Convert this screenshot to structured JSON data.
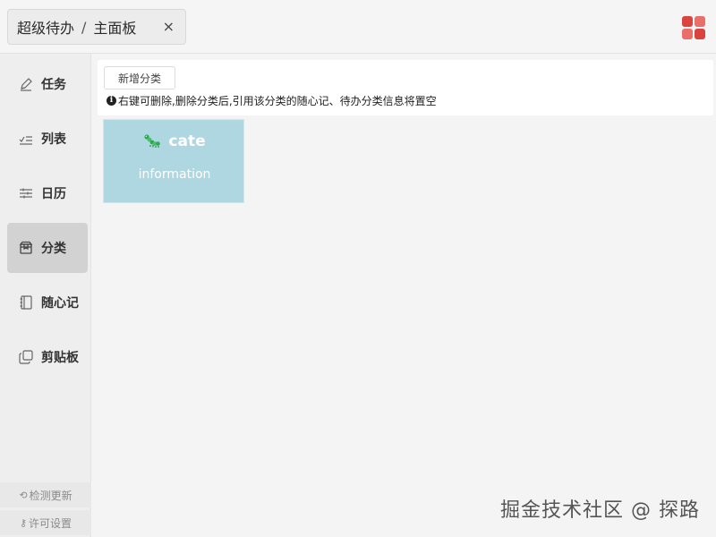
{
  "header": {
    "breadcrumb_root": "超级待办",
    "breadcrumb_sep": "/",
    "breadcrumb_current": "主面板",
    "close_glyph": "×",
    "app_icon": "app-grid-icon"
  },
  "sidebar": {
    "items": [
      {
        "label": "任务",
        "icon": "pencil-icon"
      },
      {
        "label": "列表",
        "icon": "checklist-icon"
      },
      {
        "label": "日历",
        "icon": "sliders-icon"
      },
      {
        "label": "分类",
        "icon": "box-icon",
        "active": true
      },
      {
        "label": "随心记",
        "icon": "notebook-icon"
      },
      {
        "label": "剪贴板",
        "icon": "copy-icon"
      }
    ],
    "check_update": "检测更新",
    "license": "许可设置"
  },
  "toolbar": {
    "add_button": "新增分类",
    "hint": "右键可删除,删除分类后,引用该分类的随心记、待办分类信息将置空",
    "hint_icon": "i"
  },
  "cards": [
    {
      "title": "cate",
      "description": "information",
      "icon": "caterpillar-icon",
      "color": "#afd7e1"
    }
  ],
  "watermark": "掘金技术社区 @ 探路",
  "colors": {
    "accent_red": "#d9443f",
    "card_bg": "#afd7e1",
    "active_nav": "#d2d2d2"
  }
}
